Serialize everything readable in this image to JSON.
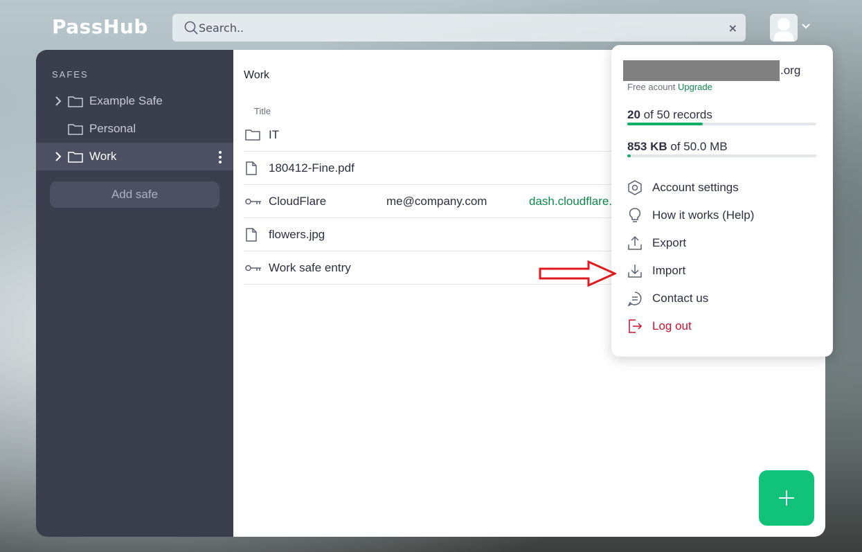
{
  "header": {
    "logo": "PassHub",
    "search_placeholder": "Search..",
    "clear_icon": "×"
  },
  "sidebar": {
    "title": "SAFES",
    "safes": [
      {
        "label": "Example Safe",
        "expandable": true,
        "active": false
      },
      {
        "label": "Personal",
        "expandable": false,
        "active": false
      },
      {
        "label": "Work",
        "expandable": true,
        "active": true
      }
    ],
    "add_safe_label": "Add safe"
  },
  "main": {
    "title": "Work",
    "column_title": "Title",
    "rows": [
      {
        "type": "folder",
        "name": "IT",
        "user": "",
        "url": ""
      },
      {
        "type": "file",
        "name": "180412-Fine.pdf",
        "user": "",
        "url": ""
      },
      {
        "type": "password",
        "name": "CloudFlare",
        "user": "me@company.com",
        "url": "dash.cloudflare."
      },
      {
        "type": "file",
        "name": "flowers.jpg",
        "user": "",
        "url": ""
      },
      {
        "type": "password",
        "name": "Work safe entry",
        "user": "",
        "url": ""
      }
    ]
  },
  "menu": {
    "email_domain": ".org",
    "plan_text": "Free acount",
    "upgrade_label": "Upgrade",
    "records": {
      "used": "20",
      "rest": " of 50 records",
      "fraction": 0.4
    },
    "storage": {
      "used": "853 KB",
      "rest": " of 50.0 MB",
      "fraction": 0.017
    },
    "items": [
      {
        "label": "Account settings",
        "icon": "gear-icon"
      },
      {
        "label": "How it works (Help)",
        "icon": "lightbulb-icon"
      },
      {
        "label": "Export",
        "icon": "export-icon"
      },
      {
        "label": "Import",
        "icon": "import-icon"
      },
      {
        "label": "Contact us",
        "icon": "chat-icon"
      },
      {
        "label": "Log out",
        "icon": "logout-icon"
      }
    ]
  },
  "colors": {
    "accent": "#10c27a",
    "sidebar_bg": "#3b3e4d",
    "link_green": "#0f8a4c",
    "logout_red": "#c8102e",
    "arrow_red": "#e0191f"
  }
}
